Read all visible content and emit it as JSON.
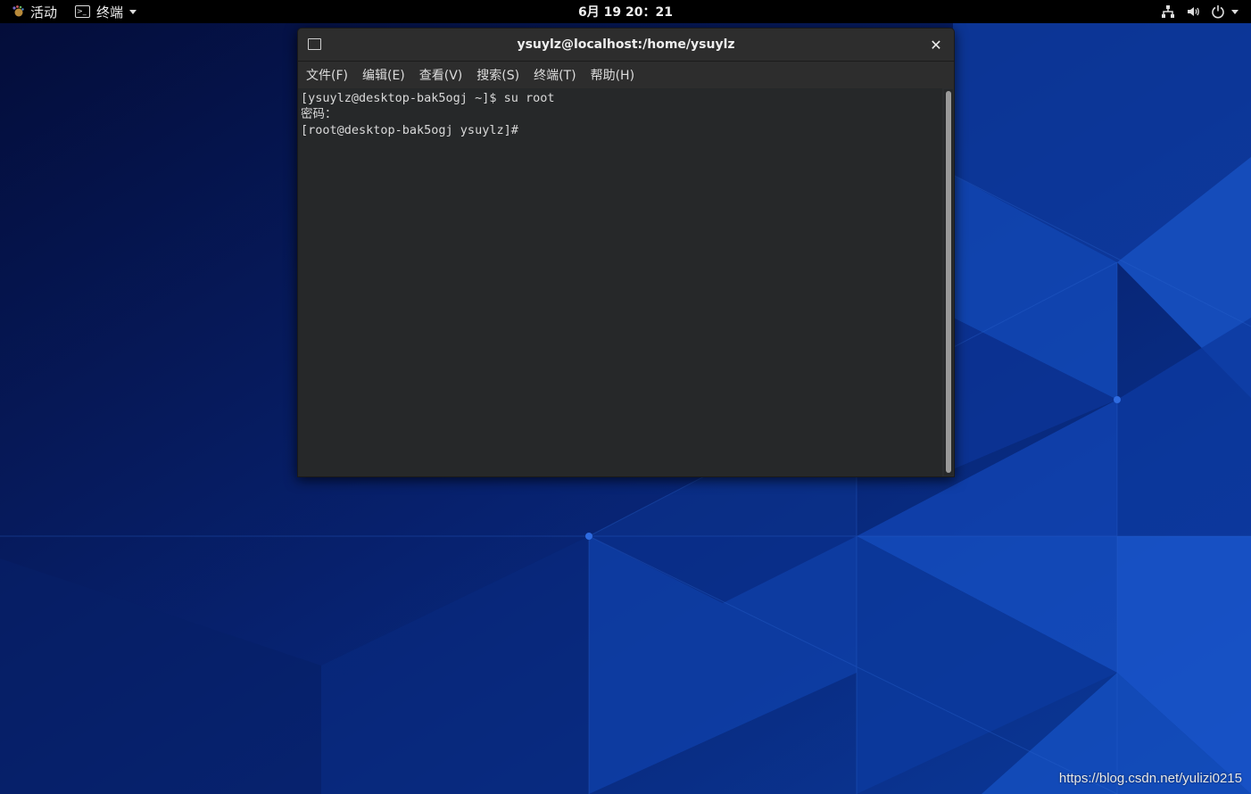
{
  "topbar": {
    "activities_label": "活动",
    "app_menu_label": "终端",
    "clock": "6月 19  20：21",
    "status_icons": [
      "network-icon",
      "volume-icon",
      "power-icon"
    ]
  },
  "terminal": {
    "title": "ysuylz@localhost:/home/ysuylz",
    "close_glyph": "✕",
    "menus": [
      "文件(F)",
      "编辑(E)",
      "查看(V)",
      "搜索(S)",
      "终端(T)",
      "帮助(H)"
    ],
    "lines": [
      "[ysuylz@desktop-bak5ogj ~]$ su root",
      "密码：",
      "[root@desktop-bak5ogj ysuylz]#"
    ]
  },
  "watermark": "https://blog.csdn.net/yulizi0215",
  "colors": {
    "wallpaper_dark": "#061a5c",
    "wallpaper_light": "#1a4fbe",
    "topbar": "#000000",
    "terminal_bg": "#262829"
  }
}
